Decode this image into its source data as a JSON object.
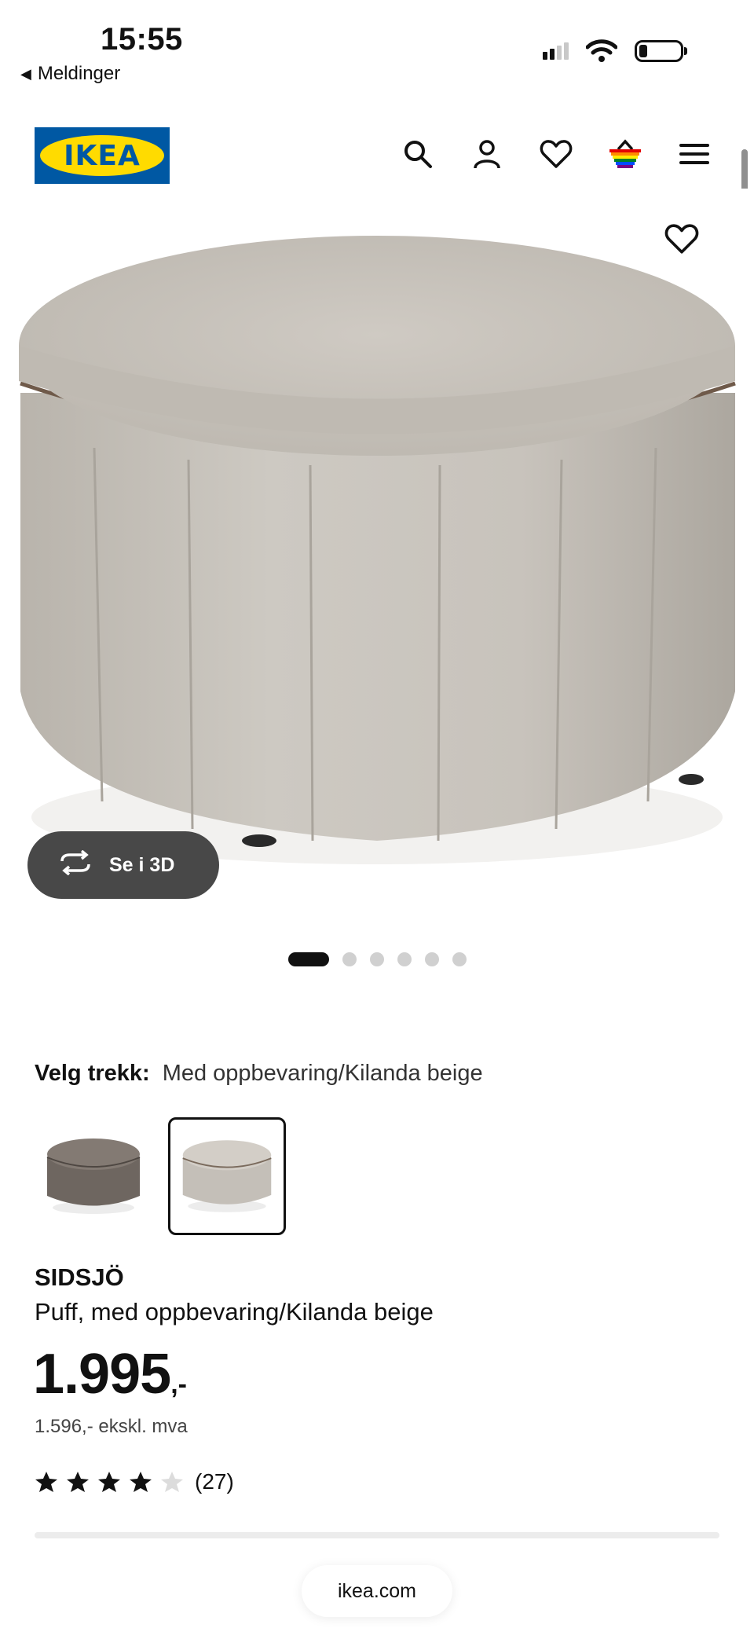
{
  "status_bar": {
    "time": "15:55",
    "back_label": "Meldinger"
  },
  "header": {
    "logo_text": "IKEA",
    "icons": [
      "search-icon",
      "account-icon",
      "wishlist-heart-icon",
      "shopping-bag-icon",
      "menu-icon"
    ]
  },
  "gallery": {
    "view_3d_label": "Se i 3D",
    "image_count": 6,
    "active_index": 0
  },
  "variant": {
    "label": "Velg trekk:",
    "selected_value": "Med oppbevaring/Kilanda beige",
    "options": [
      {
        "name": "dark-grey",
        "color": "#6e6660"
      },
      {
        "name": "beige",
        "color": "#c9c4bd",
        "selected": true
      }
    ]
  },
  "product": {
    "brand": "SIDSJÖ",
    "description": "Puff, med oppbevaring/Kilanda beige",
    "price": "1.995",
    "price_suffix": ",-",
    "price_ex_vat": "1.596,- ekskl. mva",
    "rating": 4,
    "rating_max": 5,
    "review_count": "(27)"
  },
  "browser": {
    "url": "ikea.com"
  },
  "colors": {
    "ikea_blue": "#0058a3",
    "ikea_yellow": "#ffdb00",
    "button_dark": "#484848"
  }
}
